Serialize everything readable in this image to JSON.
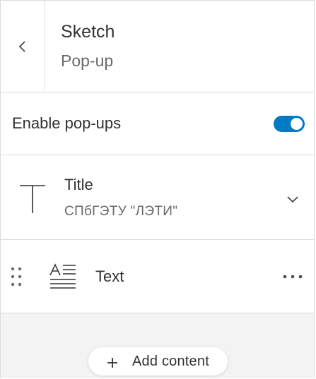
{
  "header": {
    "title": "Sketch",
    "subtitle": "Pop-up"
  },
  "toggle": {
    "label": "Enable pop-ups",
    "checked": true,
    "accent_color": "#007ac2"
  },
  "title_element": {
    "label": "Title",
    "value": "СПбГЭТУ \"ЛЭТИ\""
  },
  "text_element": {
    "label": "Text"
  },
  "footer": {
    "add_label": "Add content"
  },
  "icons": [
    "chevron-left-icon",
    "title-text-icon",
    "chevron-down-icon",
    "drag-handle-icon",
    "text-paragraph-icon",
    "more-horizontal-icon",
    "plus-icon"
  ]
}
